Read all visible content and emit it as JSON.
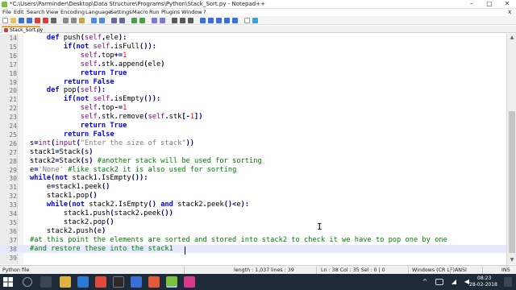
{
  "window": {
    "title": "*C:\\Users\\Parminder\\Desktop\\Data Structure\\Programs\\Python\\Stack_Sort.py - Notepad++",
    "controls": [
      "–",
      "□",
      "✕"
    ]
  },
  "menu": [
    "File",
    "Edit",
    "Search",
    "View",
    "Encoding",
    "Language",
    "Settings",
    "Macro",
    "Run",
    "Plugins",
    "Window",
    "?"
  ],
  "menu_right": "X",
  "tab": {
    "label": "Stack_Sort.py"
  },
  "editor": {
    "current_line": 38,
    "lines": [
      {
        "n": "14",
        "code": "    def push(self,ele):"
      },
      {
        "n": "15",
        "code": "        if(not self.isFull()):"
      },
      {
        "n": "16",
        "code": "            self.top+=1"
      },
      {
        "n": "17",
        "code": "            self.stk.append(ele)"
      },
      {
        "n": "18",
        "code": "            return True"
      },
      {
        "n": "19",
        "code": "        return False"
      },
      {
        "n": "20",
        "code": "    def pop(self):"
      },
      {
        "n": "21",
        "code": "        if(not self.isEmpty()):"
      },
      {
        "n": "22",
        "code": "            self.top-=1"
      },
      {
        "n": "23",
        "code": "            self.stk.remove(self.stk[-1])"
      },
      {
        "n": "24",
        "code": "            return True"
      },
      {
        "n": "25",
        "code": "        return False"
      },
      {
        "n": "26",
        "code": "s=int(input(\"Enter the size of stack\"))"
      },
      {
        "n": "27",
        "code": "stack1=Stack(s)"
      },
      {
        "n": "28",
        "code": "stack2=Stack(s) #another stack will be used for sorting"
      },
      {
        "n": "29",
        "code": "e='None' #like stack2 it is also used for sorting"
      },
      {
        "n": "30",
        "code": "while(not stack1.IsEmpty()):"
      },
      {
        "n": "31",
        "code": "    e=stack1.peek()"
      },
      {
        "n": "32",
        "code": "    stack1.pop()"
      },
      {
        "n": "33",
        "code": "    while(not stack2.IsEmpty() and stack2.peek()<e):"
      },
      {
        "n": "34",
        "code": "        stack1.push(stack2.peek())"
      },
      {
        "n": "35",
        "code": "        stack2.pop()"
      },
      {
        "n": "36",
        "code": "    stack2.push(e)"
      },
      {
        "n": "37",
        "code": "#at this point the elements are sorted and stored into stack2 to check it we have to pop one by one"
      },
      {
        "n": "38",
        "code": "#and restore these into the stack1"
      },
      {
        "n": "39",
        "code": ""
      }
    ]
  },
  "status": {
    "filetype": "Python file",
    "length": "length : 1,037",
    "lines": "lines : 39",
    "position": "Ln : 38    Col : 35    Sel : 0 | 0",
    "eol": "Windows (CR LF)",
    "encoding": "ANSI",
    "mode": "INS"
  },
  "taskbar": {
    "time": "08:23",
    "date": "28-02-2018"
  },
  "colors": {
    "keyword": "#0000ff",
    "builtin": "#8b008b",
    "number": "#ff0000",
    "string": "#808080",
    "comment": "#007f00",
    "current_line": "#e8e8ff",
    "taskbar": "#1f2a38"
  }
}
